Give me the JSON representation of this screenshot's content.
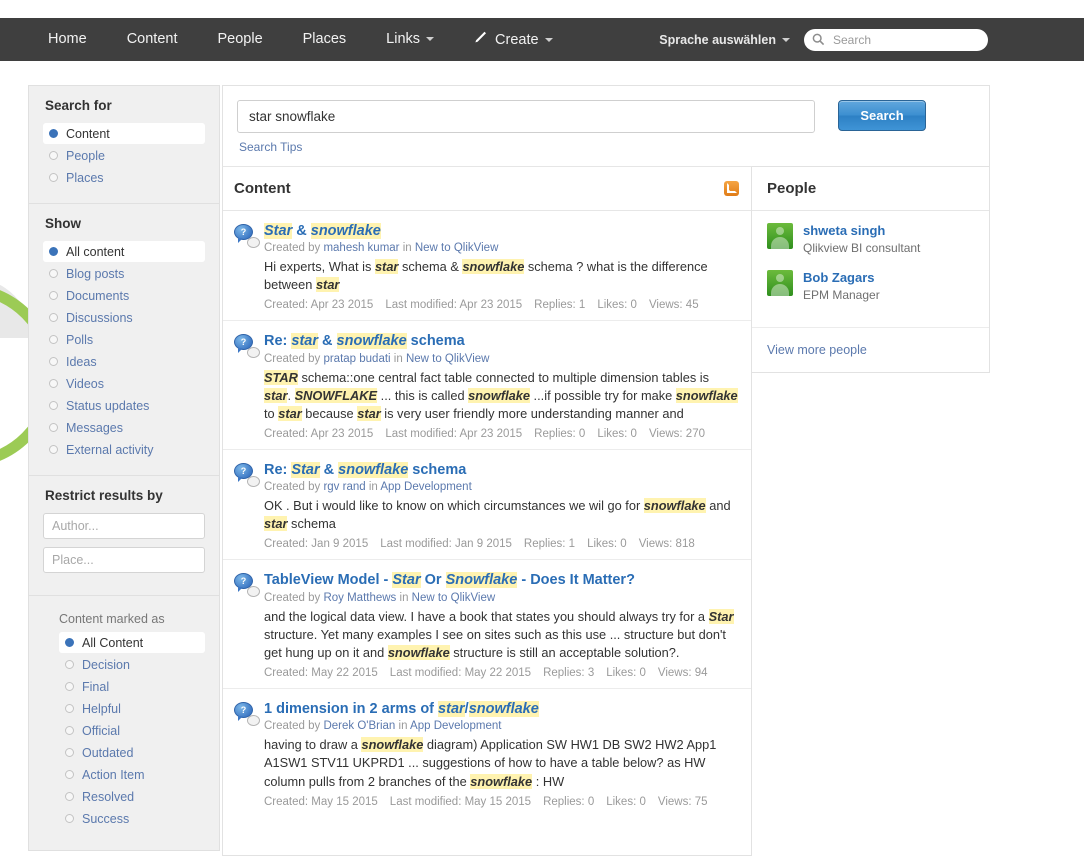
{
  "nav": {
    "items": [
      {
        "label": "Home",
        "name": "nav-home",
        "caret": false
      },
      {
        "label": "Content",
        "name": "nav-content",
        "caret": false
      },
      {
        "label": "People",
        "name": "nav-people",
        "caret": false
      },
      {
        "label": "Places",
        "name": "nav-places",
        "caret": false
      },
      {
        "label": "Links",
        "name": "nav-links",
        "caret": true
      }
    ],
    "create_label": "Create",
    "pencil_icon": "pencil-icon",
    "language_label": "Sprache auswählen",
    "search_placeholder": "Search",
    "search_value": "",
    "search_icon": "search-icon"
  },
  "sidebar": {
    "search_for": {
      "title": "Search for",
      "options": [
        {
          "label": "Content",
          "selected": true
        },
        {
          "label": "People",
          "selected": false
        },
        {
          "label": "Places",
          "selected": false
        }
      ]
    },
    "show": {
      "title": "Show",
      "options": [
        {
          "label": "All content",
          "selected": true
        },
        {
          "label": "Blog posts",
          "selected": false
        },
        {
          "label": "Documents",
          "selected": false
        },
        {
          "label": "Discussions",
          "selected": false
        },
        {
          "label": "Polls",
          "selected": false
        },
        {
          "label": "Ideas",
          "selected": false
        },
        {
          "label": "Videos",
          "selected": false
        },
        {
          "label": "Status updates",
          "selected": false
        },
        {
          "label": "Messages",
          "selected": false
        },
        {
          "label": "External activity",
          "selected": false
        }
      ]
    },
    "restrict": {
      "title": "Restrict results by",
      "author_placeholder": "Author...",
      "author_value": "",
      "place_placeholder": "Place...",
      "place_value": "",
      "marked_as_label": "Content marked as",
      "marked_options": [
        {
          "label": "All Content",
          "selected": true
        },
        {
          "label": "Decision",
          "selected": false
        },
        {
          "label": "Final",
          "selected": false
        },
        {
          "label": "Helpful",
          "selected": false
        },
        {
          "label": "Official",
          "selected": false
        },
        {
          "label": "Outdated",
          "selected": false
        },
        {
          "label": "Action Item",
          "selected": false
        },
        {
          "label": "Resolved",
          "selected": false
        },
        {
          "label": "Success",
          "selected": false
        }
      ]
    }
  },
  "search": {
    "query_value": "star snowflake",
    "query_placeholder": "",
    "button_label": "Search",
    "tips_label": "Search Tips"
  },
  "content": {
    "heading": "Content",
    "rss_icon": "rss-icon",
    "results": [
      {
        "icon": "discussion-question-icon",
        "title_html": "<em class=\"hl\">Star</em> &amp; <em class=\"hl\">snowflake</em>",
        "created_by_prefix": "Created by ",
        "author": "mahesh kumar",
        "in_word": " in ",
        "place": "New to QlikView",
        "snippet_html": "Hi experts, What is <em class=\"hl\">star</em> schema &amp; <em class=\"hl\">snowflake</em> schema ? what is the difference between <em class=\"hl\">star</em>",
        "created": "Created: Apr 23 2015",
        "modified": "Last modified: Apr 23 2015",
        "replies": "Replies: 1",
        "likes": "Likes: 0",
        "views": "Views: 45"
      },
      {
        "icon": "discussion-question-icon",
        "title_html": "Re: <em class=\"hl\">star</em> &amp; <em class=\"hl\">snowflake</em> schema",
        "created_by_prefix": "Created by ",
        "author": "pratap budati",
        "in_word": " in ",
        "place": "New to QlikView",
        "snippet_html": "<em class=\"hl\">STAR</em> schema::one central fact table connected to multiple dimension tables is <em class=\"hl\">star</em>. <em class=\"hl\">SNOWFLAKE</em> ... this is called <em class=\"hl\">snowflake</em> ...if possible try for make <em class=\"hl\">snowflake</em> to <em class=\"hl\">star</em> because <em class=\"hl\">star</em> is very user friendly more understanding manner and",
        "created": "Created: Apr 23 2015",
        "modified": "Last modified: Apr 23 2015",
        "replies": "Replies: 0",
        "likes": "Likes: 0",
        "views": "Views: 270"
      },
      {
        "icon": "discussion-question-icon",
        "title_html": "Re: <em class=\"hl\">Star</em> &amp; <em class=\"hl\">snowflake</em> schema",
        "created_by_prefix": "Created by ",
        "author": "rgv rand",
        "in_word": " in ",
        "place": "App Development",
        "snippet_html": "OK . But i would like to know on which circumstances we wil go for <em class=\"hl\">snowflake</em> and <em class=\"hl\">star</em> schema",
        "created": "Created: Jan 9 2015",
        "modified": "Last modified: Jan 9 2015",
        "replies": "Replies: 1",
        "likes": "Likes: 0",
        "views": "Views: 818"
      },
      {
        "icon": "discussion-question-icon",
        "title_html": "TableView Model - <em class=\"hl\">Star</em> Or <em class=\"hl\">Snowflake</em> - Does It Matter?",
        "created_by_prefix": "Created by ",
        "author": "Roy Matthews",
        "in_word": " in ",
        "place": "New to QlikView",
        "snippet_html": "and the logical data view. I have a book that states you should always try for a <em class=\"hl\">Star</em> structure. Yet many examples I see on sites such as this use ... structure but don't get hung up on it and <em class=\"hl\">snowflake</em> structure is still an acceptable solution?.",
        "created": "Created: May 22 2015",
        "modified": "Last modified: May 22 2015",
        "replies": "Replies: 3",
        "likes": "Likes: 0",
        "views": "Views: 94"
      },
      {
        "icon": "discussion-question-icon",
        "title_html": "1 dimension in 2 arms of <em class=\"hl\">star</em>/<em class=\"hl\">snowflake</em>",
        "created_by_prefix": "Created by ",
        "author": "Derek O'Brian",
        "in_word": " in ",
        "place": "App Development",
        "snippet_html": "having to draw a <em class=\"hl\">snowflake</em> diagram)  Application SW HW1 DB SW2 HW2 App1 A1SW1 STV11 UKPRD1 ... suggestions of how to have a table below? as HW column pulls from 2 branches of the <em class=\"hl\">snowflake</em> : HW",
        "created": "Created: May 15 2015",
        "modified": "Last modified: May 15 2015",
        "replies": "Replies: 0",
        "likes": "Likes: 0",
        "views": "Views: 75"
      }
    ]
  },
  "people": {
    "heading": "People",
    "items": [
      {
        "name": "shweta singh",
        "title": "Qlikview BI consultant",
        "avatar": "avatar-icon"
      },
      {
        "name": "Bob Zagars",
        "title": "EPM Manager",
        "avatar": "avatar-icon"
      }
    ],
    "view_more_label": "View more people"
  },
  "colors": {
    "nav_bg": "#3f3f3f",
    "accent_blue": "#2a6db5",
    "link_blue": "#5b79ad",
    "highlight": "#fff3b0",
    "green_arc": "#9ccb55",
    "button_blue": "#3b8ed0"
  }
}
